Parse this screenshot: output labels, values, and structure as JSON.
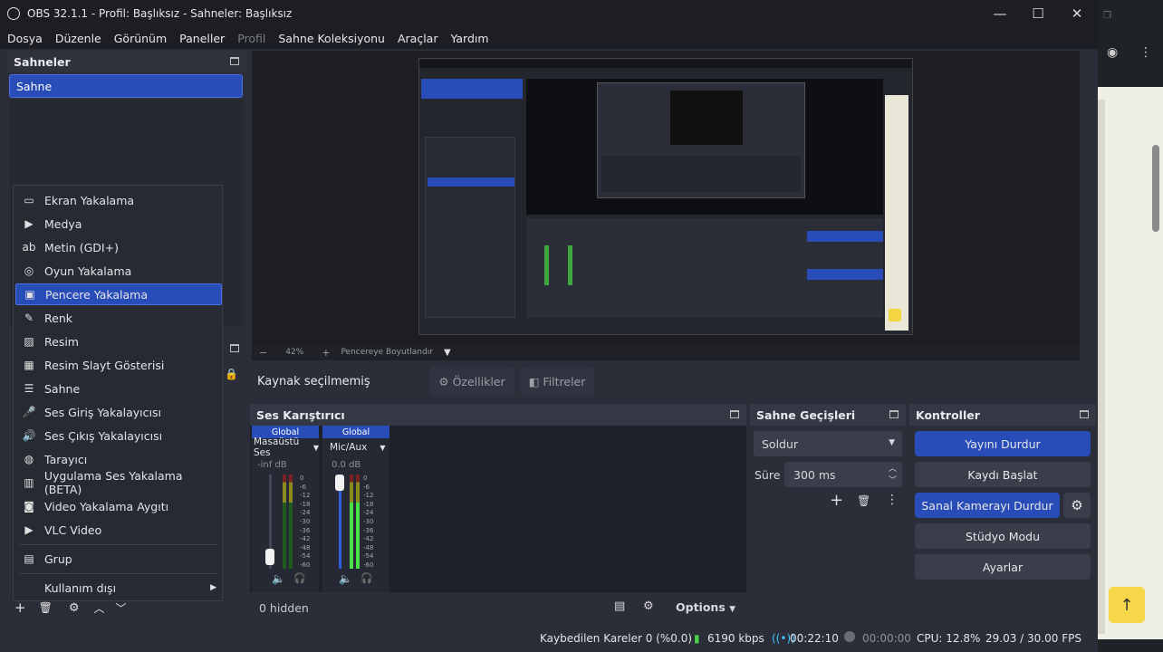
{
  "window": {
    "title": "OBS 32.1.1 - Profil: Başlıksız - Sahneler: Başlıksız"
  },
  "menu": [
    "Dosya",
    "Düzenle",
    "Görünüm",
    "Paneller",
    "Profil",
    "Sahne Koleksiyonu",
    "Araçlar",
    "Yardım"
  ],
  "scenes": {
    "title": "Sahneler",
    "items": [
      "Sahne"
    ]
  },
  "source_menu": {
    "items": [
      "Ekran Yakalama",
      "Medya",
      "Metin (GDI+)",
      "Oyun Yakalama",
      "Pencere Yakalama",
      "Renk",
      "Resim",
      "Resim Slayt Gösterisi",
      "Sahne",
      "Ses Giriş Yakalayıcısı",
      "Ses Çıkış Yakalayıcısı",
      "Tarayıcı",
      "Uygulama Ses Yakalama (BETA)",
      "Video Yakalama Aygıtı",
      "VLC Video",
      "Grup",
      "Kullanım dışı"
    ],
    "icons": [
      "monitor-icon",
      "play-icon",
      "text-icon",
      "gamepad-icon",
      "window-icon",
      "brush-icon",
      "image-icon",
      "slideshow-icon",
      "list-icon",
      "mic-icon",
      "speaker-icon",
      "globe-icon",
      "app-audio-icon",
      "camera-icon",
      "play-icon",
      "folder-icon",
      "submenu-arrow-icon"
    ],
    "active_index": 4
  },
  "preview": {
    "zoom_minus": "−",
    "zoom": "42%",
    "zoom_plus": "+",
    "fit": "Pencereye Boyutlandır"
  },
  "source_bar": {
    "status": "Kaynak seçilmemiş",
    "properties": "Özellikler",
    "filters": "Filtreler"
  },
  "mixer": {
    "title": "Ses Karıştırıcı",
    "channels": [
      {
        "badge": "Global",
        "name": "Masaüstü Ses",
        "level": "-inf dB"
      },
      {
        "badge": "Global",
        "name": "Mic/Aux",
        "level": "0.0 dB"
      }
    ],
    "scale": [
      "0",
      "-6",
      "-12",
      "-18",
      "-24",
      "-30",
      "-36",
      "-42",
      "-48",
      "-54",
      "-60"
    ],
    "hidden": "0 hidden",
    "options": "Options"
  },
  "transitions": {
    "title": "Sahne Geçişleri",
    "type": "Soldur",
    "duration_label": "Süre",
    "duration": "300 ms"
  },
  "controls": {
    "title": "Kontroller",
    "buttons": [
      "Yayını Durdur",
      "Kaydı Başlat",
      "Sanal Kamerayı Durdur",
      "Stüdyo Modu",
      "Ayarlar"
    ]
  },
  "status": {
    "dropped": "Kaybedilen Kareler 0 (%0.0)",
    "bitrate": "6190 kbps",
    "stream_time": "00:22:10",
    "rec_time": "00:00:00",
    "cpu": "CPU: 12.8%",
    "fps": "29.03 / 30.00 FPS"
  },
  "colors": {
    "accent": "#284cb8",
    "panel": "#2b2e38",
    "live": "#3cc3ff"
  }
}
